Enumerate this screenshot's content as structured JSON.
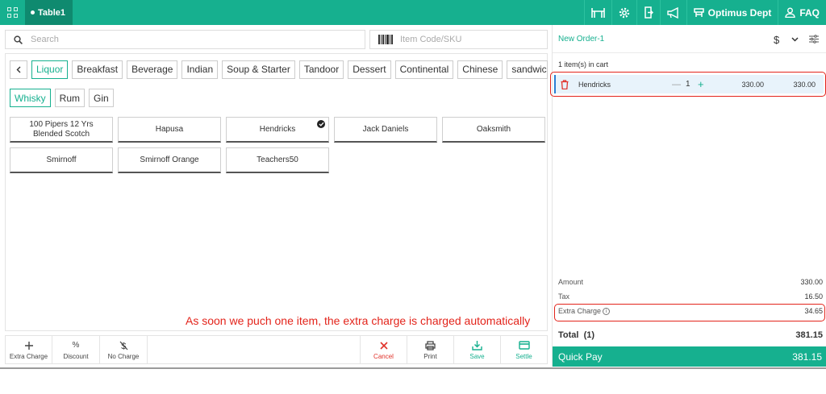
{
  "header": {
    "table_tab": "Table1",
    "department": "Optimus Dept",
    "faq": "FAQ",
    "icons": [
      "grid-icon",
      "table-icon",
      "settings-icon",
      "exit-icon",
      "announcement-icon",
      "department-icon",
      "user-icon"
    ]
  },
  "search": {
    "placeholder": "Search",
    "sku_placeholder": "Item Code/SKU"
  },
  "categories": {
    "items": [
      "Liquor",
      "Breakfast",
      "Beverage",
      "Indian",
      "Soup & Starter",
      "Tandoor",
      "Dessert",
      "Continental",
      "Chinese",
      "sandwic"
    ],
    "active": "Liquor"
  },
  "subcategories": {
    "items": [
      "Whisky",
      "Rum",
      "Gin"
    ],
    "active": "Whisky"
  },
  "menu_items": [
    "100 Pipers 12 Yrs Blended Scotch",
    "Hapusa",
    "Hendricks",
    "Jack Daniels",
    "Oaksmith",
    "Smirnoff",
    "Smirnoff Orange",
    "Teachers50"
  ],
  "selected_item": "Hendricks",
  "annotation": "As soon we puch one item, the extra charge is charged automatically",
  "actions": {
    "extra_charge": "Extra Charge",
    "discount": "Discount",
    "no_charge": "No Charge",
    "cancel": "Cancel",
    "print": "Print",
    "save": "Save",
    "settle": "Settle"
  },
  "order": {
    "title": "New Order-1",
    "cart_count": "1 item(s) in cart",
    "lines": [
      {
        "name": "Hendricks",
        "qty": "1",
        "price": "330.00",
        "total": "330.00"
      }
    ],
    "amount_label": "Amount",
    "amount": "330.00",
    "tax_label": "Tax",
    "tax": "16.50",
    "extra_charge_label": "Extra Charge",
    "extra_charge": "34.65",
    "total_label": "Total",
    "total_count": "(1)",
    "total": "381.15",
    "quick_pay_label": "Quick Pay",
    "quick_pay": "381.15"
  },
  "colors": {
    "accent": "#16b08f",
    "accent_dark": "#0f8a6f",
    "highlight": "#e3241b",
    "cart_line": "#e8f3fb"
  }
}
